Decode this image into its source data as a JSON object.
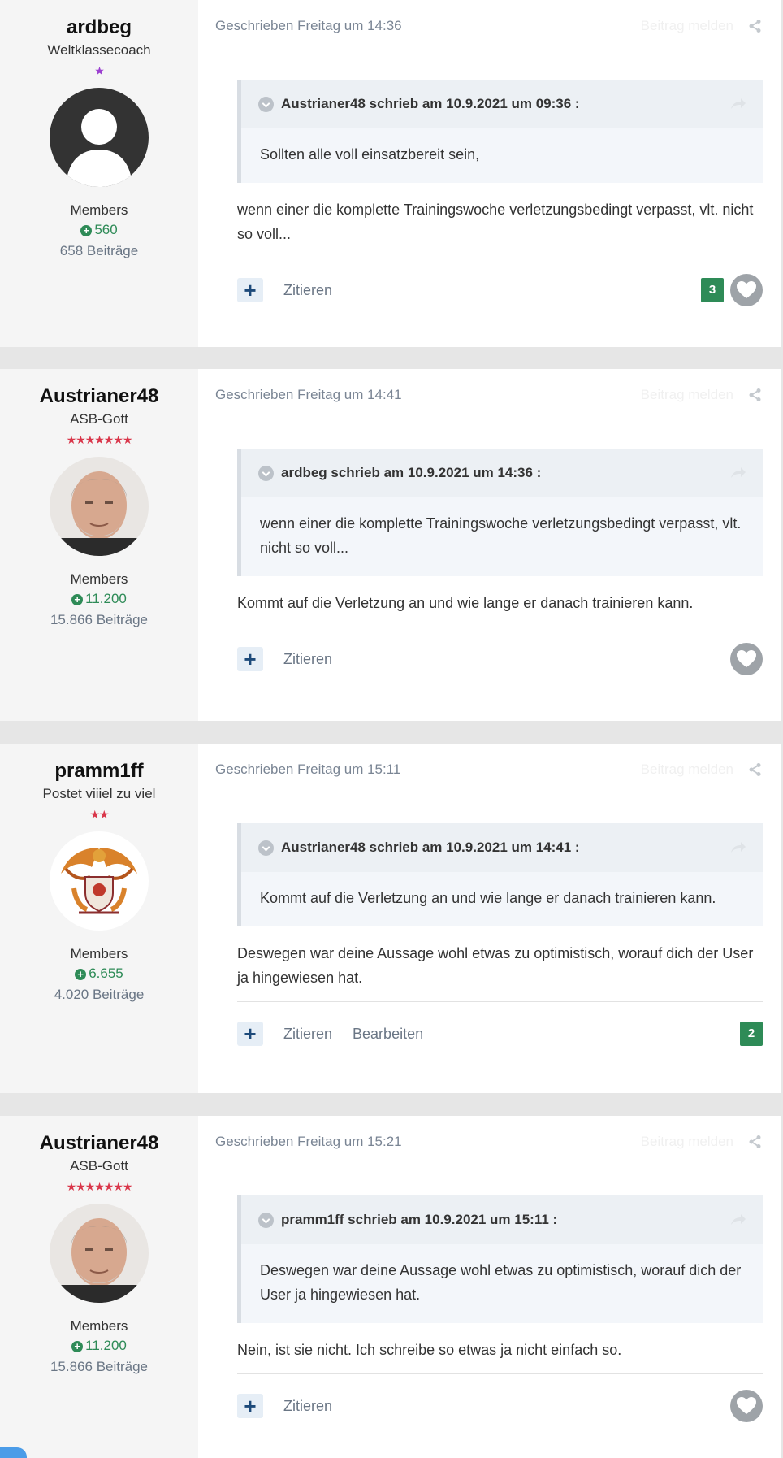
{
  "common": {
    "report_label": "Beitrag melden",
    "quote_label": "Zitieren",
    "edit_label": "Bearbeiten",
    "plus_label": "+",
    "rep_icon": "+"
  },
  "colors": {
    "reputation_green": "#2e8b57",
    "rank_purple": "#9b3fd0",
    "rank_red": "#d9364a",
    "link_blue": "#1d4a7a"
  },
  "icons": [
    "share-icon",
    "chevron-down-icon",
    "reply-arrow-icon",
    "heart-icon",
    "plus-icon"
  ],
  "posts": [
    {
      "author": {
        "name": "ardbeg",
        "title": "Weltklassecoach",
        "rank": "★",
        "group": "Members",
        "reputation": "560",
        "posts": "658 Beiträge"
      },
      "date": "Geschrieben Freitag um 14:36",
      "quote": {
        "title": "Austrianer48 schrieb am 10.9.2021 um 09:36 :",
        "text": "Sollten alle voll einsatzbereit sein,"
      },
      "text": " wenn einer die komplette Trainingswoche verletzungsbedingt verpasst, vlt. nicht so voll...",
      "reactions": "3"
    },
    {
      "author": {
        "name": "Austrianer48",
        "title": "ASB-Gott",
        "rank": "★★★★★★★",
        "group": "Members",
        "reputation": "11.200",
        "posts": "15.866 Beiträge"
      },
      "date": "Geschrieben Freitag um 14:41",
      "quote": {
        "title": "ardbeg schrieb am 10.9.2021 um 14:36 :",
        "text": " wenn einer die komplette Trainingswoche verletzungsbedingt verpasst, vlt. nicht so voll..."
      },
      "text": "Kommt auf die Verletzung an und wie lange er danach trainieren kann."
    },
    {
      "author": {
        "name": "pramm1ff",
        "title": "Postet viiiel zu viel",
        "rank": "★★",
        "group": "Members",
        "reputation": "6.655",
        "posts": "4.020 Beiträge"
      },
      "date": "Geschrieben Freitag um 15:11",
      "quote": {
        "title": "Austrianer48 schrieb am 10.9.2021 um 14:41 :",
        "text": "Kommt auf die Verletzung an und wie lange er danach trainieren kann."
      },
      "text": "Deswegen war deine Aussage wohl etwas zu optimistisch, worauf dich der User ja hingewiesen hat.",
      "reactions": "2"
    },
    {
      "author": {
        "name": "Austrianer48",
        "title": "ASB-Gott",
        "rank": "★★★★★★★",
        "group": "Members",
        "reputation": "11.200",
        "posts": "15.866 Beiträge"
      },
      "date": "Geschrieben Freitag um 15:21",
      "quote": {
        "title": "pramm1ff schrieb am 10.9.2021 um 15:11 :",
        "text": "Deswegen war deine Aussage wohl etwas zu optimistisch, worauf dich der User ja hingewiesen hat."
      },
      "text": "Nein, ist sie nicht. Ich schreibe so etwas ja nicht einfach so."
    }
  ]
}
